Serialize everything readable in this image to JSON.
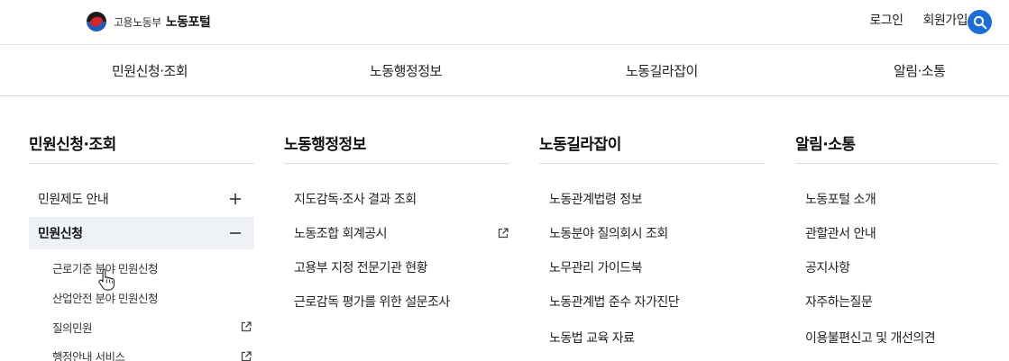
{
  "header": {
    "ministry": "고용노동부",
    "portal": "노동포털",
    "links": [
      "로그인",
      "회원가입"
    ],
    "search_icon": "search-icon",
    "colors": {
      "accent": "#1b6ed8",
      "logo_red": "#d8232a",
      "logo_blue": "#1e5bb8"
    }
  },
  "nav": [
    "민원신청·조회",
    "노동행정정보",
    "노동길라잡이",
    "알림·소통"
  ],
  "mega": {
    "col1": {
      "title": "민원신청·조회",
      "acc1": {
        "label": "민원제도 안내",
        "toggle": "plus-icon"
      },
      "acc2": {
        "label": "민원신청",
        "toggle": "minus-icon"
      },
      "subs": [
        "근로기준 분야 민원신청",
        "산업안전 분야 민원신청",
        "질의민원",
        "행정안내 서비스"
      ],
      "active_bg": "#eef1f6"
    },
    "col2": {
      "title": "노동행정정보",
      "items": [
        "지도감독·조사 결과 조회",
        "노동조합 회계공시",
        "고용부 지정 전문기관 현황",
        "근로감독 평가를 위한 설문조사"
      ]
    },
    "col3": {
      "title": "노동길라잡이",
      "items": [
        "노동관계법령 정보",
        "노동분야 질의회시 조회",
        "노무관리 가이드북",
        "노동관계법 준수 자가진단",
        "노동법 교육 자료"
      ]
    },
    "col4": {
      "title": "알림·소통",
      "items": [
        "노동포털 소개",
        "관할관서 안내",
        "공지사항",
        "자주하는질문",
        "이용불편신고 및 개선의견"
      ]
    }
  }
}
